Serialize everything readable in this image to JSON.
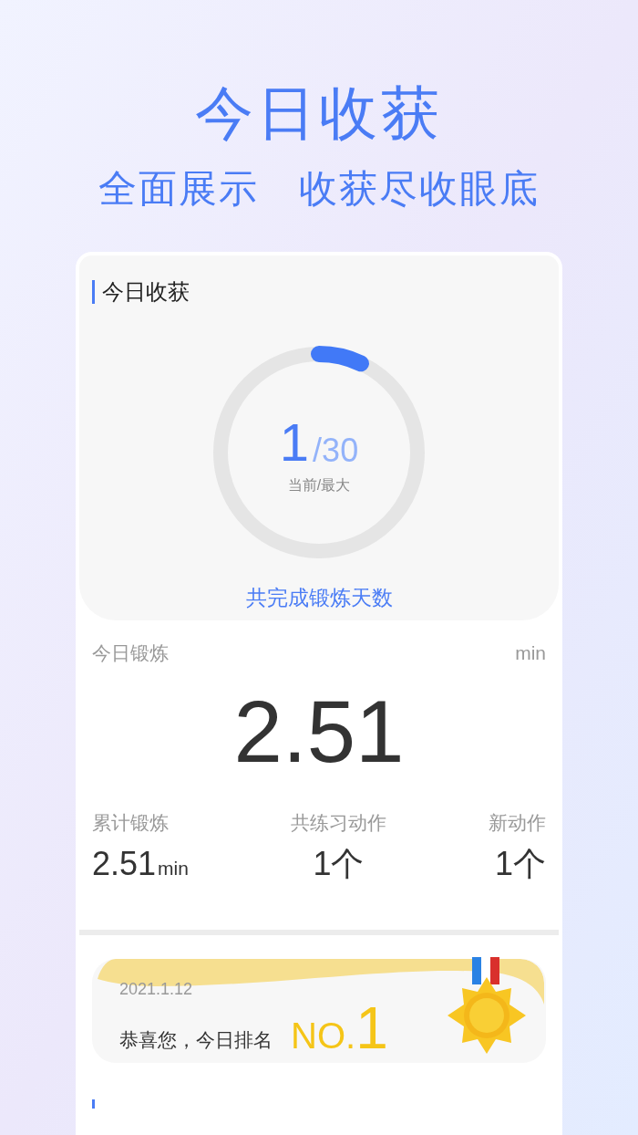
{
  "headline": "今日收获",
  "subheadline": [
    "全面展示",
    "收获尽收眼底"
  ],
  "progress_card": {
    "title": "今日收获",
    "current": "1",
    "maximum": "/30",
    "caption": "当前/最大",
    "footer": "共完成锻炼天数"
  },
  "today": {
    "label": "今日锻炼",
    "unit": "min",
    "value": "2.51"
  },
  "stats": [
    {
      "label": "累计锻炼",
      "value": "2.51",
      "unit": "min"
    },
    {
      "label": "共练习动作",
      "value": "1个"
    },
    {
      "label": "新动作",
      "value": "1个"
    }
  ],
  "rank_card": {
    "date": "2021.1.12",
    "message": "恭喜您，今日排名",
    "rank_prefix": "NO.",
    "rank": "1"
  }
}
